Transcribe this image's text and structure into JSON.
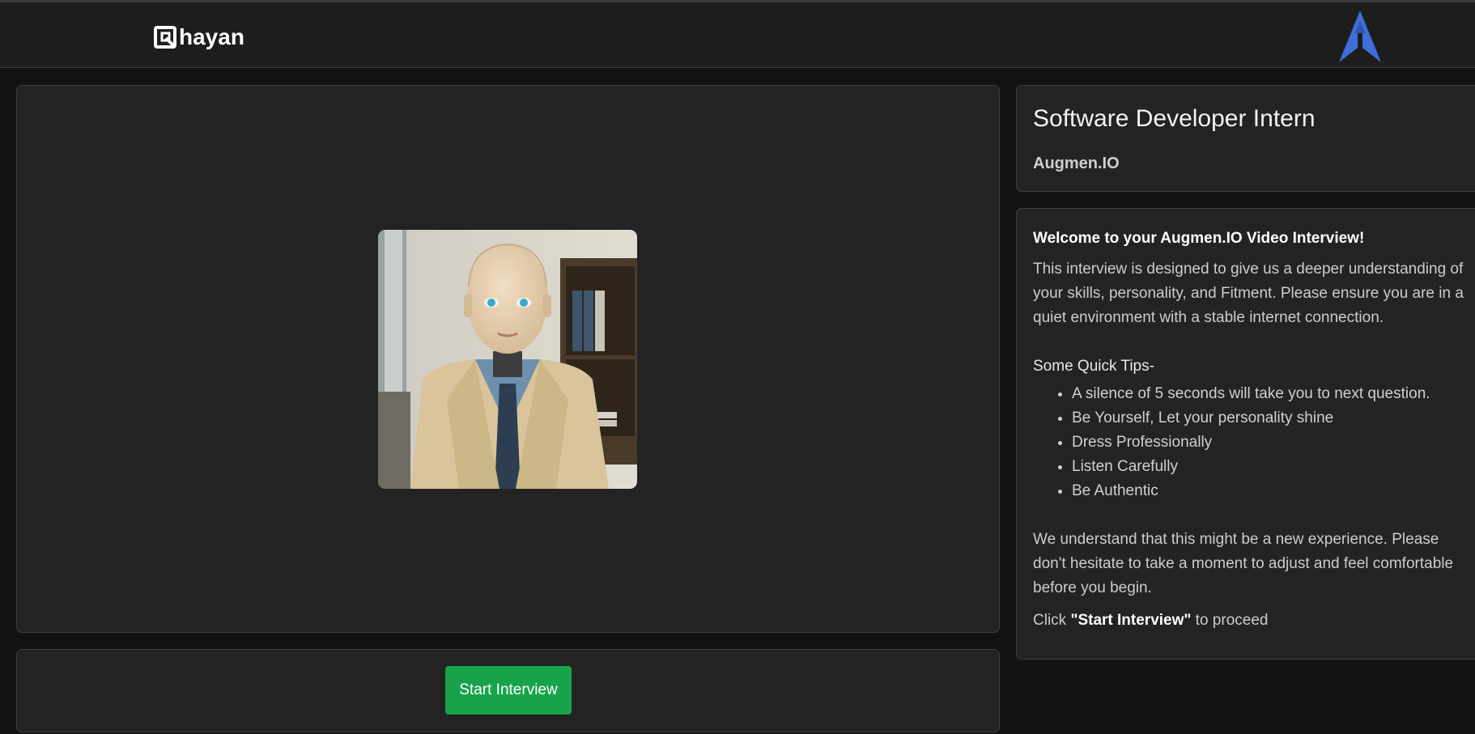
{
  "header": {
    "brand_name": "hayan",
    "brand_icon": "q-square-logo-icon",
    "right_logo": "blue-a-logo-icon"
  },
  "video": {
    "avatar": "interviewer-avatar-image"
  },
  "controls": {
    "start_label": "Start Interview"
  },
  "job": {
    "title": "Software Developer Intern",
    "company": "Augmen.IO"
  },
  "info": {
    "welcome": "Welcome to your Augmen.IO Video Interview!",
    "intro_lines": [
      "This interview is designed to give us a deeper understanding of",
      "your skills, personality, and Fitment. Please ensure you are in a",
      "quiet environment with a stable internet connection."
    ],
    "tips_title": "Some Quick Tips-",
    "tips": [
      "A silence of 5 seconds will take you to next question.",
      "Be Yourself, Let your personality shine",
      "Dress Professionally",
      "Listen Carefully",
      "Be Authentic"
    ],
    "closing_lines": [
      "We understand that this might be a new experience. Please",
      "don't hesitate to take a moment to adjust and feel comfortable",
      "before you begin."
    ],
    "click_prefix": "Click ",
    "click_bold": "\"Start Interview\"",
    "click_suffix": " to proceed"
  },
  "colors": {
    "accent_green": "#18a34a",
    "logo_blue": "#3d6fd6",
    "background": "#121212",
    "card": "#232323"
  }
}
